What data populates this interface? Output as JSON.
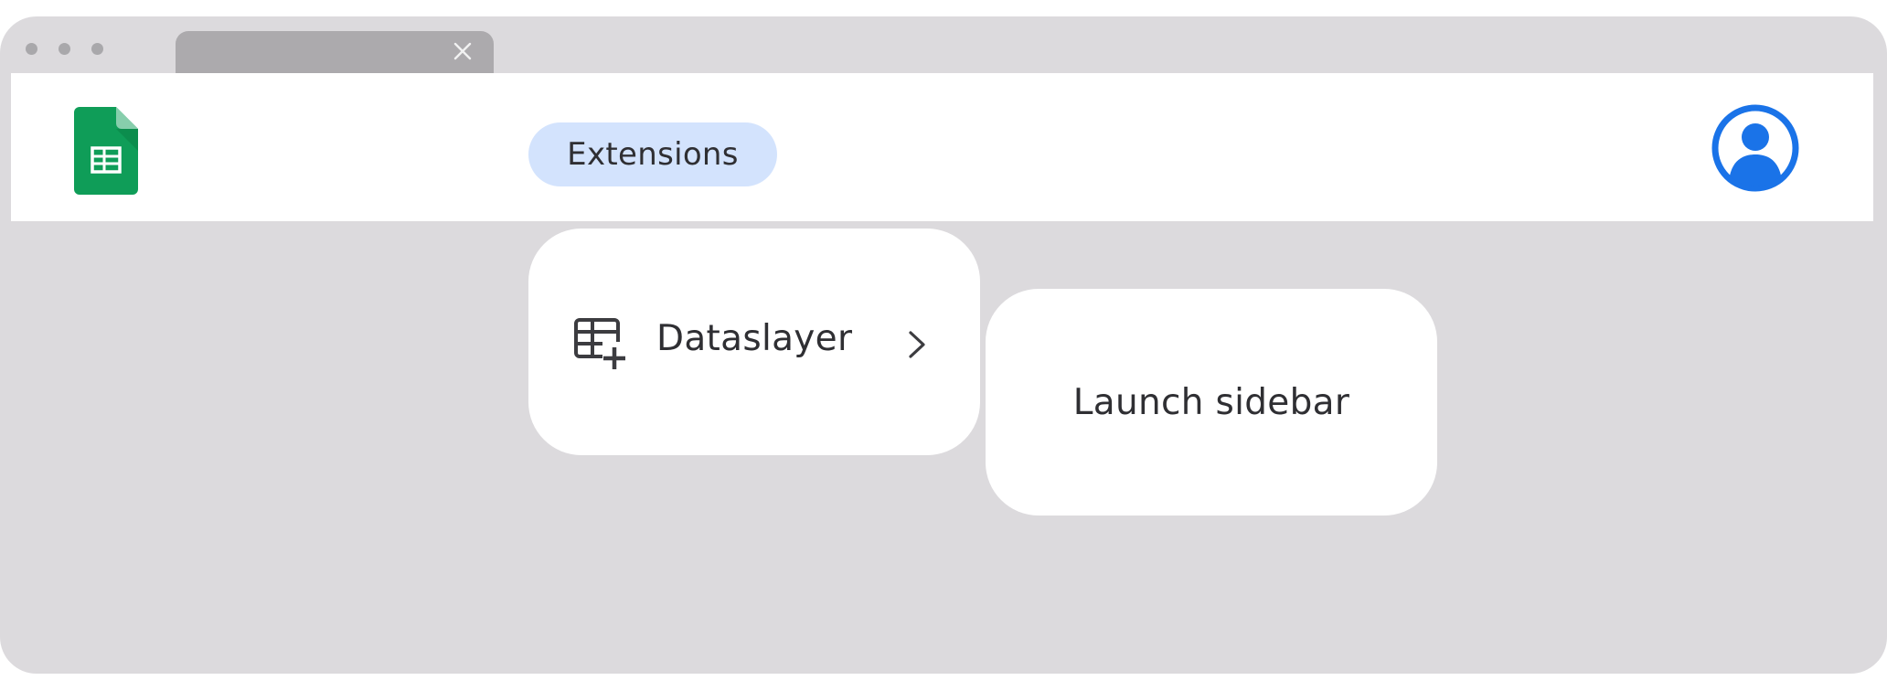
{
  "browser": {
    "tab_close_icon": "close-icon"
  },
  "appbar": {
    "logo_icon": "google-sheets-icon",
    "account_icon": "account-circle-icon"
  },
  "menu": {
    "extensions_label": "Extensions",
    "dataslayer_label": "Dataslayer",
    "dataslayer_icon": "table-add-icon",
    "submenu_icon": "chevron-right-icon",
    "launch_sidebar_label": "Launch sidebar"
  },
  "colors": {
    "window_bg": "#dcdadd",
    "tab_bg": "#acaaad",
    "pill_bg": "#d3e3fd",
    "sheets_green": "#0f9d58",
    "account_blue": "#1a73e8",
    "text": "#2f2f33"
  }
}
